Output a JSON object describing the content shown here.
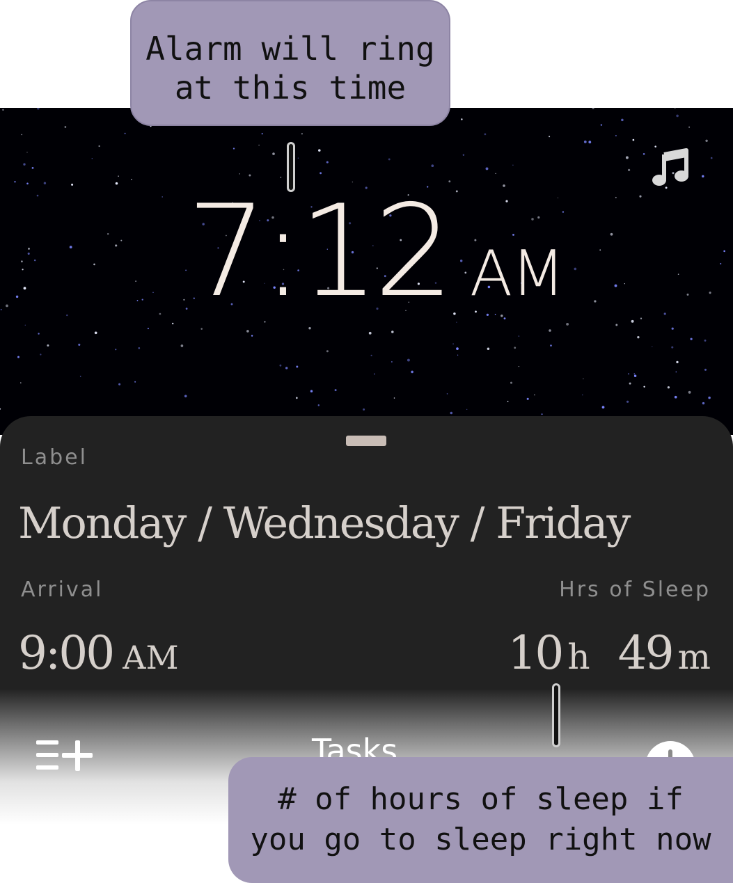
{
  "callouts": {
    "alarm_line1": "Alarm will ring",
    "alarm_line2": "at this time",
    "sleep_line1": "# of hours of sleep if",
    "sleep_line2": "you go to sleep right now"
  },
  "alarm": {
    "time": "7:12",
    "ampm": "AM"
  },
  "icons": {
    "music": "music-note-icon",
    "tasks": "add-list-icon",
    "clock": "clock-icon"
  },
  "sheet": {
    "label_caption": "Label",
    "label_value": "Monday / Wednesday / Friday",
    "arrival_caption": "Arrival",
    "arrival_time": "9:00",
    "arrival_ampm": "AM",
    "sleep_caption": "Hrs of Sleep",
    "sleep_hours": "10",
    "sleep_hours_unit": "h",
    "sleep_minutes": "49",
    "sleep_minutes_unit": "m"
  },
  "nav": {
    "tasks_label": "Tasks"
  },
  "colors": {
    "sky": "#000005",
    "sheet": "#222222",
    "callout": "#a198b6",
    "time_text": "#f4ebe4"
  }
}
